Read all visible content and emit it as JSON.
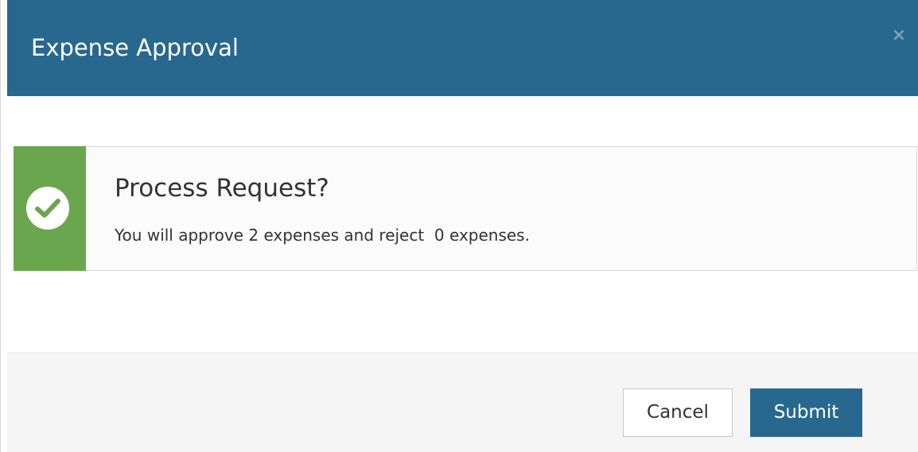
{
  "header": {
    "title": "Expense Approval",
    "close_symbol": "×",
    "background_color": "#28688f"
  },
  "alert": {
    "icon": "check-circle-icon",
    "accent_color": "#6aa64e",
    "title": "Process Request?",
    "message": "You will approve 2 expenses and reject  0 expenses."
  },
  "footer": {
    "cancel_label": "Cancel",
    "submit_label": "Submit"
  }
}
